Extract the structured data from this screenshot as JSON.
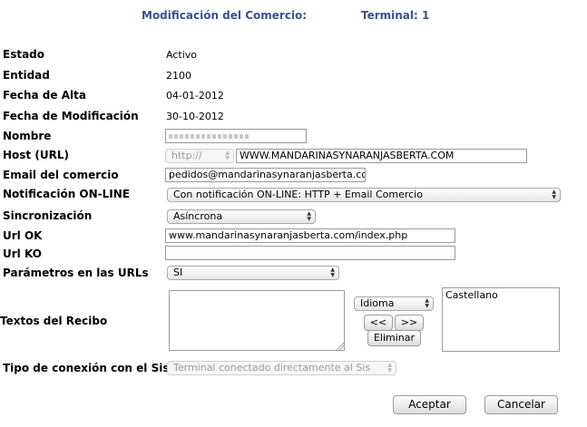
{
  "header": {
    "title": "Modificación del Comercio:",
    "terminal": "Terminal: 1"
  },
  "fields": {
    "estado": {
      "label": "Estado",
      "value": "Activo"
    },
    "entidad": {
      "label": "Entidad",
      "value": "2100"
    },
    "fecha_alta": {
      "label": "Fecha de Alta",
      "value": "04-01-2012"
    },
    "fecha_mod": {
      "label": "Fecha de Modificación",
      "value": "30-10-2012"
    },
    "nombre": {
      "label": "Nombre",
      "value": ""
    },
    "host": {
      "label": "Host (URL)",
      "protocol": "http://",
      "value": "WWW.MANDARINASYNARANJASBERTA.COM"
    },
    "email": {
      "label": "Email del comercio",
      "value": "pedidos@mandarinasynaranjasberta.com"
    },
    "notificacion": {
      "label": "Notificación ON-LINE",
      "value": "Con notificación ON-LINE: HTTP + Email Comercio"
    },
    "sincronizacion": {
      "label": "Sincronización",
      "value": "Asíncrona"
    },
    "url_ok": {
      "label": "Url OK",
      "value": "www.mandarinasynaranjasberta.com/index.php"
    },
    "url_ko": {
      "label": "Url KO",
      "value": ""
    },
    "parametros": {
      "label": "Parámetros en las URLs",
      "value": "SI"
    },
    "textos": {
      "label": "Textos del Recibo",
      "idioma": "Idioma",
      "prev": "<<",
      "next": ">>",
      "eliminar": "Eliminar",
      "languages": [
        "Castellano"
      ]
    },
    "conexion": {
      "label": "Tipo de conexión con el Sis",
      "value": "Terminal conectado directamente al Sis"
    }
  },
  "buttons": {
    "accept": "Aceptar",
    "cancel": "Cancelar"
  }
}
